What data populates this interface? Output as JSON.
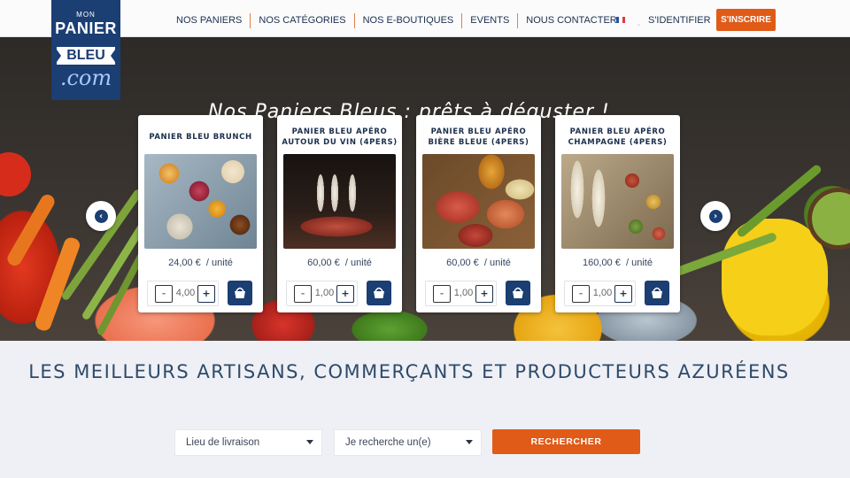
{
  "logo": {
    "top": "MON",
    "line1": "PANIER",
    "line2": "BLEU",
    "line3": ".com"
  },
  "nav": {
    "items": [
      "NOS PANIERS",
      "NOS CATÉGORIES",
      "NOS E-BOUTIQUES",
      "EVENTS",
      "NOUS CONTACTER"
    ]
  },
  "header": {
    "login_label": "S'IDENTIFIER",
    "signup_label": "S'INSCRIRE",
    "language_flag": "fr-flag-icon"
  },
  "hero": {
    "title": "Nos Paniers Bleus : prêts à déguster !",
    "prev_icon": "arrow-left-icon",
    "next_icon": "arrow-right-icon"
  },
  "products": [
    {
      "title": "PANIER BLEU BRUNCH",
      "price": "24,00 €",
      "unit": "/ unité",
      "qty": "4,00",
      "minus": "-",
      "plus": "+",
      "image": "brunch-photo"
    },
    {
      "title": "PANIER BLEU APÉRO AUTOUR DU VIN (4PERS)",
      "price": "60,00 €",
      "unit": "/ unité",
      "qty": "1,00",
      "minus": "-",
      "plus": "+",
      "image": "wine-charcuterie-photo"
    },
    {
      "title": "PANIER BLEU APÉRO BIÈRE BLEUE (4PERS)",
      "price": "60,00 €",
      "unit": "/ unité",
      "qty": "1,00",
      "minus": "-",
      "plus": "+",
      "image": "beer-platter-photo"
    },
    {
      "title": "PANIER BLEU APÉRO CHAMPAGNE (4PERS)",
      "price": "160,00 €",
      "unit": "/ unité",
      "qty": "1,00",
      "minus": "-",
      "plus": "+",
      "image": "champagne-canapes-photo"
    }
  ],
  "search": {
    "tagline": "LES MEILLEURS ARTISANS, COMMERÇANTS ET PRODUCTEURS AZURÉENS",
    "delivery_placeholder": "Lieu de livraison",
    "category_placeholder": "Je recherche un(e)",
    "button_label": "RECHERCHER"
  },
  "colors": {
    "brand_blue": "#1b3e73",
    "accent_orange": "#e05a18"
  }
}
